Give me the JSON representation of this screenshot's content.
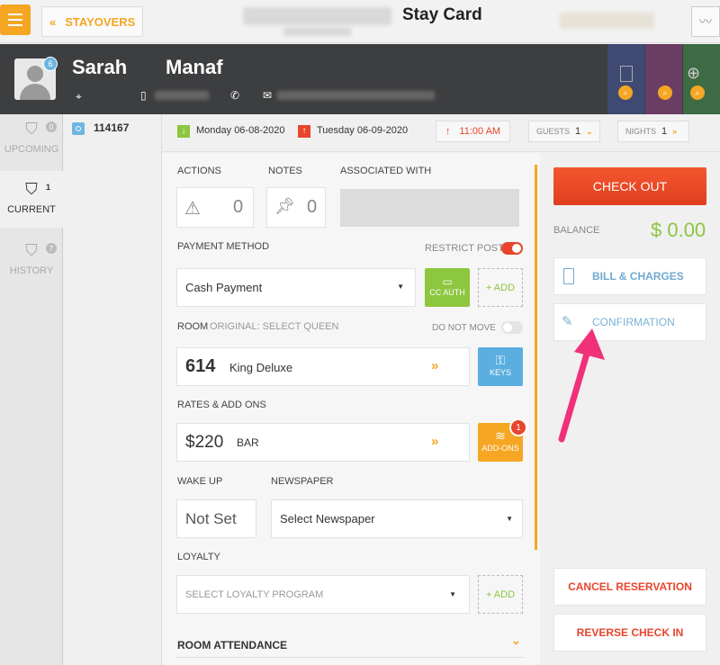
{
  "topbar": {
    "back_label": "STAYOVERS",
    "title": "Stay Card"
  },
  "guest": {
    "first_name": "Sarah",
    "last_name": "Manaf",
    "avatar_badge": "6"
  },
  "sidebar": {
    "items": [
      {
        "label": "UPCOMING",
        "count": "0"
      },
      {
        "label": "CURRENT",
        "count": "1"
      },
      {
        "label": "HISTORY",
        "count": "7"
      }
    ]
  },
  "reservation": {
    "number": "114167"
  },
  "dates": {
    "arrival": "Monday 06-08-2020",
    "departure": "Tuesday 06-09-2020",
    "time": "11:00 AM",
    "guests_label": "GUESTS",
    "guests_value": "1",
    "nights_label": "NIGHTS",
    "nights_value": "1"
  },
  "actions": {
    "label": "ACTIONS",
    "count": "0"
  },
  "notes": {
    "label": "NOTES",
    "count": "0"
  },
  "associated": {
    "label": "ASSOCIATED WITH"
  },
  "payment": {
    "label": "PAYMENT METHOD",
    "restrict_label": "RESTRICT POST",
    "method": "Cash Payment",
    "cc_auth": "CC AUTH",
    "add": "+ ADD"
  },
  "room": {
    "label": "ROOM",
    "original": "ORIGINAL: SELECT QUEEN",
    "do_not_move": "DO NOT MOVE",
    "number": "614",
    "type": "King Deluxe",
    "keys": "KEYS"
  },
  "rates": {
    "label": "RATES & ADD ONS",
    "amount": "$220",
    "code": "BAR",
    "addons": "ADD-ONS",
    "addons_count": "1"
  },
  "wakeup": {
    "label": "WAKE UP",
    "value": "Not Set"
  },
  "newspaper": {
    "label": "NEWSPAPER",
    "value": "Select Newspaper"
  },
  "loyalty": {
    "label": "LOYALTY",
    "placeholder": "SELECT LOYALTY PROGRAM",
    "add": "+ ADD"
  },
  "attendance": {
    "label": "ROOM ATTENDANCE"
  },
  "right": {
    "checkout": "CHECK OUT",
    "balance_label": "BALANCE",
    "balance_value": "$ 0.00",
    "bill": "BILL & CHARGES",
    "confirmation": "CONFIRMATION",
    "cancel": "CANCEL RESERVATION",
    "reverse": "REVERSE CHECK IN"
  },
  "colors": {
    "accent": "#f5a623",
    "green": "#8dc63f",
    "red": "#e8452c",
    "link": "#7ab3d4",
    "arrow": "#f0307a"
  }
}
